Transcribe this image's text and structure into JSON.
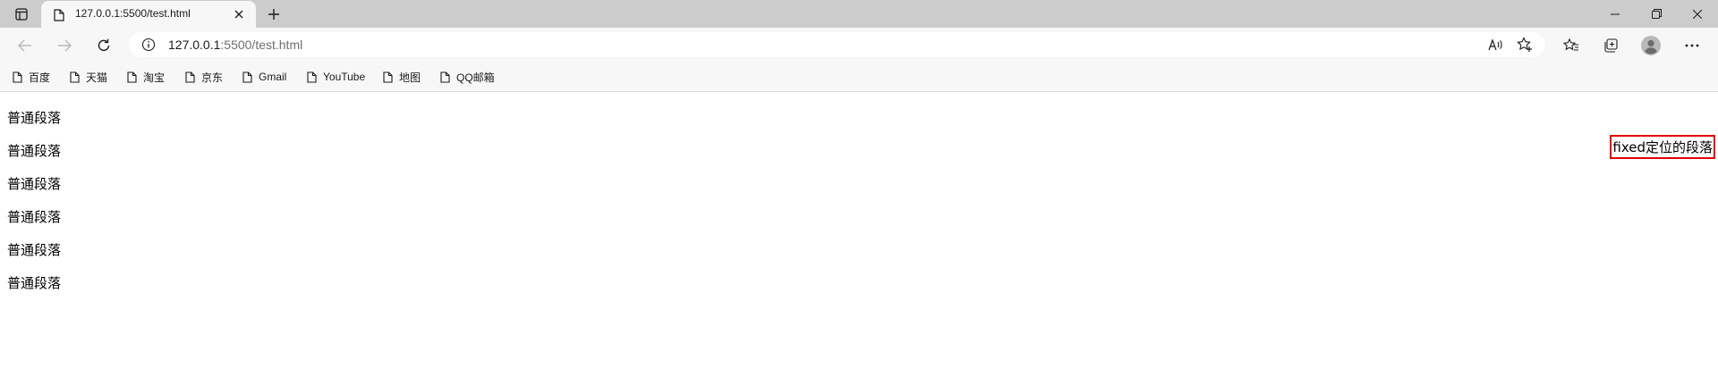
{
  "browser": {
    "tab": {
      "title": "127.0.0.1:5500/test.html"
    },
    "address": {
      "host": "127.0.0.1",
      "path": ":5500/test.html"
    },
    "bookmarks": [
      "百度",
      "天猫",
      "淘宝",
      "京东",
      "Gmail",
      "YouTube",
      "地图",
      "QQ邮箱"
    ]
  },
  "page": {
    "paragraphs": [
      "普通段落",
      "普通段落",
      "普通段落",
      "普通段落",
      "普通段落",
      "普通段落"
    ],
    "fixed_paragraph": "fixed定位的段落",
    "fixed_border_color": "#e00000"
  }
}
